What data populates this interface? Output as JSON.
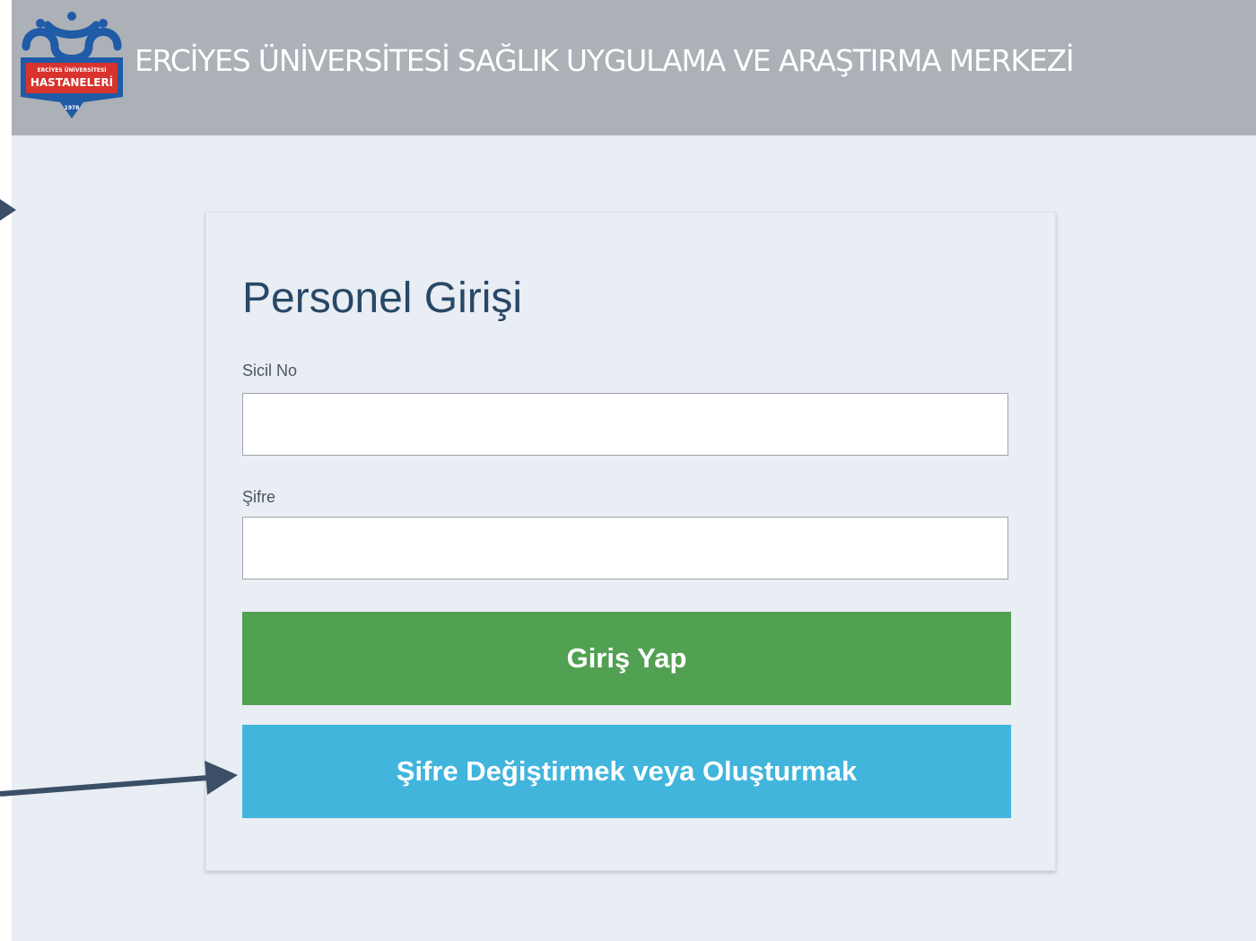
{
  "header": {
    "title": "ERCİYES ÜNİVERSİTESİ SAĞLIK UYGULAMA VE ARAŞTIRMA MERKEZİ",
    "logo_icon": "hospital-logo-icon",
    "logo_text_top": "ERCİYES ÜNİVERSİTESİ",
    "logo_text_main": "HASTANELERİ",
    "logo_text_year": "1978",
    "background_color": "#acb0b7"
  },
  "login_card": {
    "title": "Personel Girişi",
    "username": {
      "label": "Sicil No",
      "value": "",
      "placeholder": ""
    },
    "password": {
      "label": "Şifre",
      "value": "",
      "placeholder": ""
    },
    "login_button": "Giriş Yap",
    "change_password_button": "Şifre Değiştirmek veya Oluşturmak"
  },
  "colors": {
    "login_button": "#52a052",
    "change_password_button": "#41b5dc",
    "title_text": "#274866",
    "page_background": "#e9edf4",
    "annotation_arrow": "#3b4f66"
  },
  "annotations": [
    {
      "icon": "arrow-right-icon",
      "points_to": "login-card"
    },
    {
      "icon": "arrow-right-icon",
      "points_to": "change-password-button"
    }
  ]
}
